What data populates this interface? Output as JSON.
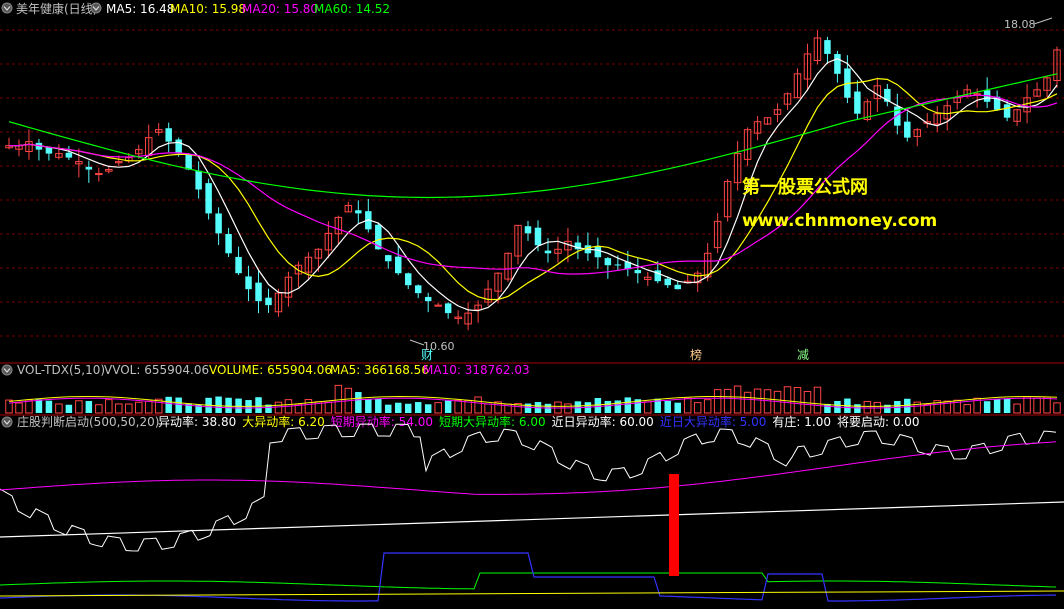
{
  "colors": {
    "background": "#000000",
    "up": "#ff4444",
    "down": "#54fcfc",
    "ma5": "#ffffff",
    "ma10": "#ffff00",
    "ma20": "#ff00ff",
    "ma60": "#00ff00",
    "grid": "#7a0000",
    "separator": "#aa0000",
    "watermark": "#ffff00",
    "label_text": "#c0c0c0",
    "tag_bg": "#ffcc88"
  },
  "main_panel": {
    "name": "美年健康(日线)",
    "ma5_label": "MA5: 16.48",
    "ma10_label": "MA10: 15.98",
    "ma20_label": "MA20: 15.80",
    "ma60_label": "MA60: 14.52",
    "high_label": "18.08",
    "low_label": "10.60",
    "tags": [
      "财",
      "榜",
      "减"
    ],
    "watermark_cn": "第一股票公式网",
    "watermark_url": "www.chnmoney.com"
  },
  "volume_panel": {
    "name": "VOL-TDX(5,10)",
    "vvol_label": "VVOL: 655904.06",
    "volume_label": "VOLUME: 655904.06",
    "ma5_label": "MA5: 366168.56",
    "ma10_label": "MA10: 318762.03"
  },
  "indicator_panel": {
    "name": "庄股判断启动(500,50,20)",
    "items": [
      {
        "label": "异动率: 38.80",
        "color": "#ffffff"
      },
      {
        "label": "大异动率: 6.20",
        "color": "#ffff00"
      },
      {
        "label": "短期异动率: 54.00",
        "color": "#ff00ff"
      },
      {
        "label": "短期大异动率: 6.00",
        "color": "#00ff00"
      },
      {
        "label": "近日异动率: 60.00",
        "color": "#ffffff"
      },
      {
        "label": "近日大异动率: 5.00",
        "color": "#3333ff"
      },
      {
        "label": "有庄: 1.00",
        "color": "#ffffff"
      },
      {
        "label": "将要启动: 0.00",
        "color": "#ffffff"
      }
    ]
  },
  "chart_data": {
    "type": "candlestick",
    "price_range": [
      10.2,
      18.3
    ],
    "days": 106,
    "closes": [
      15.2,
      15.2,
      15.3,
      15.1,
      15.0,
      15.0,
      14.9,
      14.8,
      14.6,
      14.5,
      14.6,
      14.8,
      14.9,
      15.1,
      15.4,
      15.6,
      15.3,
      15.0,
      14.6,
      14.1,
      13.5,
      13.0,
      12.5,
      12.0,
      11.6,
      11.3,
      11.2,
      11.5,
      11.9,
      12.2,
      12.4,
      12.6,
      13.0,
      13.4,
      13.7,
      13.5,
      13.1,
      12.6,
      12.3,
      12.0,
      11.7,
      11.5,
      11.3,
      11.2,
      11.0,
      10.9,
      11.0,
      11.2,
      11.6,
      12.0,
      12.5,
      13.2,
      13.0,
      12.7,
      12.5,
      12.6,
      12.8,
      12.6,
      12.5,
      12.4,
      12.2,
      12.2,
      12.1,
      12.0,
      11.9,
      11.8,
      11.7,
      11.6,
      11.8,
      12.0,
      12.5,
      13.3,
      14.3,
      15.0,
      15.6,
      15.8,
      15.9,
      16.1,
      16.5,
      17.0,
      17.5,
      17.9,
      17.5,
      17.0,
      16.4,
      16.0,
      16.3,
      16.7,
      16.3,
      15.7,
      15.4,
      15.6,
      15.8,
      16.0,
      16.2,
      16.4,
      16.6,
      16.5,
      16.3,
      16.1,
      15.9,
      16.1,
      16.4,
      16.6,
      16.9,
      17.6
    ]
  }
}
